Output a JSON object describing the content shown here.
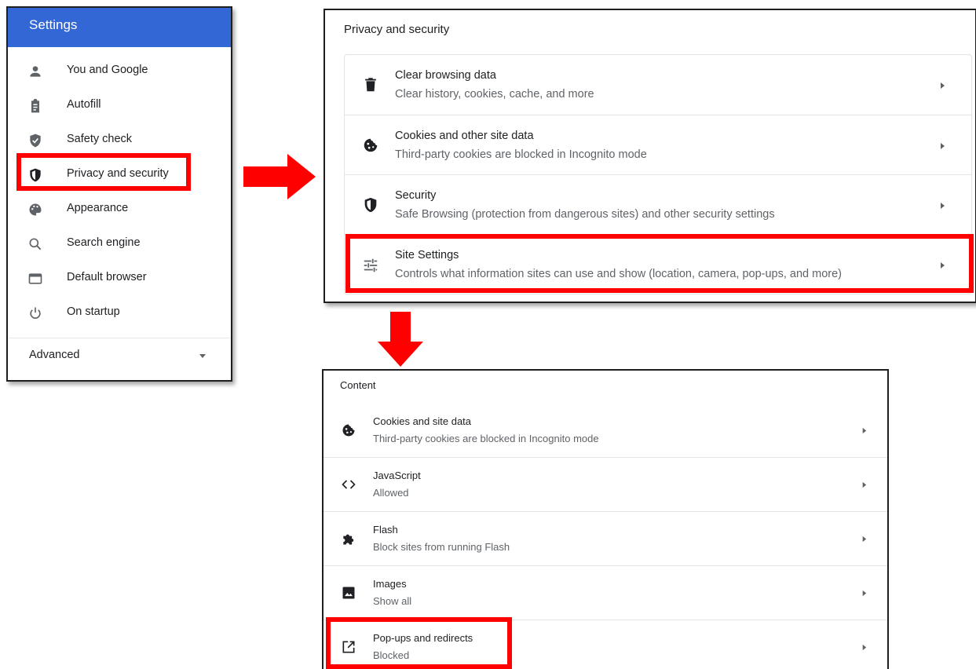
{
  "sidebar": {
    "title": "Settings",
    "items": [
      {
        "label": "You and Google",
        "icon": "person-icon"
      },
      {
        "label": "Autofill",
        "icon": "clipboard-icon"
      },
      {
        "label": "Safety check",
        "icon": "shield-check-icon"
      },
      {
        "label": "Privacy and security",
        "icon": "shield-half-icon"
      },
      {
        "label": "Appearance",
        "icon": "palette-icon"
      },
      {
        "label": "Search engine",
        "icon": "search-icon"
      },
      {
        "label": "Default browser",
        "icon": "browser-window-icon"
      },
      {
        "label": "On startup",
        "icon": "power-icon"
      }
    ],
    "advanced_label": "Advanced"
  },
  "privacy": {
    "title": "Privacy and security",
    "rows": [
      {
        "title": "Clear browsing data",
        "subtitle": "Clear history, cookies, cache, and more",
        "icon": "trash-icon"
      },
      {
        "title": "Cookies and other site data",
        "subtitle": "Third-party cookies are blocked in Incognito mode",
        "icon": "cookie-icon"
      },
      {
        "title": "Security",
        "subtitle": "Safe Browsing (protection from dangerous sites) and other security settings",
        "icon": "shield-half-icon"
      },
      {
        "title": "Site Settings",
        "subtitle": "Controls what information sites can use and show (location, camera, pop-ups, and more)",
        "icon": "tune-icon"
      }
    ]
  },
  "content": {
    "title": "Content",
    "rows": [
      {
        "title": "Cookies and site data",
        "subtitle": "Third-party cookies are blocked in Incognito mode",
        "icon": "cookie-icon"
      },
      {
        "title": "JavaScript",
        "subtitle": "Allowed",
        "icon": "code-icon"
      },
      {
        "title": "Flash",
        "subtitle": "Block sites from running Flash",
        "icon": "puzzle-icon"
      },
      {
        "title": "Images",
        "subtitle": "Show all",
        "icon": "image-icon"
      },
      {
        "title": "Pop-ups and redirects",
        "subtitle": "Blocked",
        "icon": "open-external-icon"
      }
    ]
  },
  "colors": {
    "header_blue": "#3367d6",
    "highlight_red": "#ff0000",
    "icon_gray": "#5f6368",
    "text_dark": "#202124"
  }
}
